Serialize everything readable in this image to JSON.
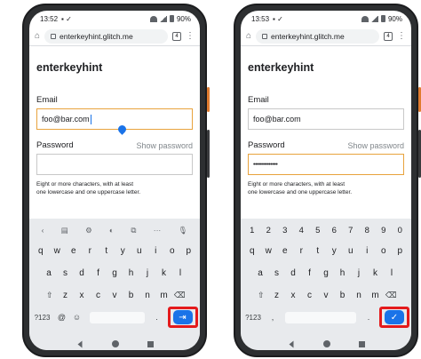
{
  "left_phone": {
    "status": {
      "time": "13:52",
      "battery": "90%"
    },
    "browser": {
      "url": "enterkeyhint.glitch.me",
      "tab_count": "4"
    },
    "page": {
      "title": "enterkeyhint",
      "email_label": "Email",
      "email_value": "foo@bar.com",
      "password_label": "Password",
      "show_password": "Show password",
      "password_value": "",
      "hint_line1": "Eight or more characters, with at least",
      "hint_line2": "one lowercase and one uppercase letter."
    },
    "keyboard": {
      "toolbar": [
        "‹",
        "☺",
        "⚙",
        "🎨",
        "▣",
        "···",
        "🎙"
      ],
      "row1": [
        "q",
        "w",
        "e",
        "r",
        "t",
        "y",
        "u",
        "i",
        "o",
        "p"
      ],
      "row2": [
        "a",
        "s",
        "d",
        "f",
        "g",
        "h",
        "j",
        "k",
        "l"
      ],
      "row3": [
        "z",
        "x",
        "c",
        "v",
        "b",
        "n",
        "m"
      ],
      "sym": "?123",
      "at": "@",
      "emoji": "☺",
      "dot": ".",
      "action_label": "⇥",
      "action_meaning": "next"
    }
  },
  "right_phone": {
    "status": {
      "time": "13:53",
      "battery": "90%"
    },
    "browser": {
      "url": "enterkeyhint.glitch.me",
      "tab_count": "4"
    },
    "page": {
      "title": "enterkeyhint",
      "email_label": "Email",
      "email_value": "foo@bar.com",
      "password_label": "Password",
      "show_password": "Show password",
      "password_value": "••••••••••••••",
      "hint_line1": "Eight or more characters, with at least",
      "hint_line2": "one lowercase and one uppercase letter."
    },
    "keyboard": {
      "row0": [
        "1",
        "2",
        "3",
        "4",
        "5",
        "6",
        "7",
        "8",
        "9",
        "0"
      ],
      "row1": [
        "q",
        "w",
        "e",
        "r",
        "t",
        "y",
        "u",
        "i",
        "o",
        "p"
      ],
      "row2": [
        "a",
        "s",
        "d",
        "f",
        "g",
        "h",
        "j",
        "k",
        "l"
      ],
      "row3": [
        "z",
        "x",
        "c",
        "v",
        "b",
        "n",
        "m"
      ],
      "sym": "?123",
      "comma": ",",
      "dot": ".",
      "action_label": "✓",
      "action_meaning": "done"
    }
  },
  "colors": {
    "accent": "#1a73e8",
    "focus": "#e8a33d",
    "highlight": "#e41a1c",
    "frame": "#2d2f31"
  }
}
